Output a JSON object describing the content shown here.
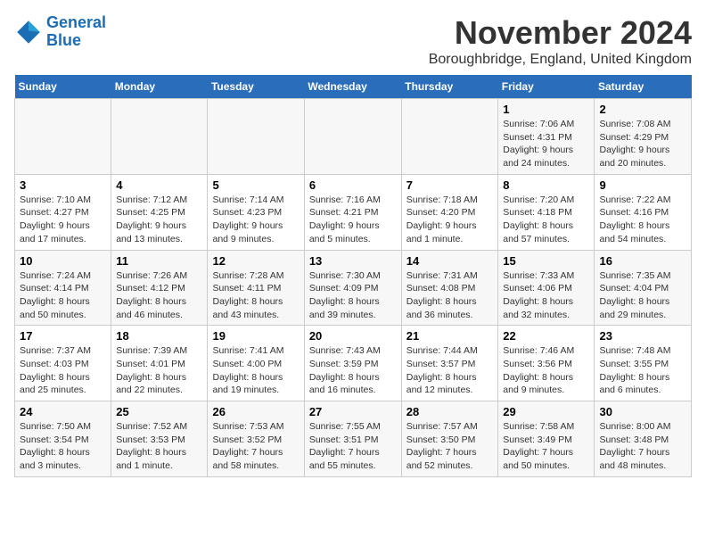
{
  "logo": {
    "line1": "General",
    "line2": "Blue"
  },
  "title": "November 2024",
  "location": "Boroughbridge, England, United Kingdom",
  "weekdays": [
    "Sunday",
    "Monday",
    "Tuesday",
    "Wednesday",
    "Thursday",
    "Friday",
    "Saturday"
  ],
  "weeks": [
    [
      {
        "day": "",
        "info": ""
      },
      {
        "day": "",
        "info": ""
      },
      {
        "day": "",
        "info": ""
      },
      {
        "day": "",
        "info": ""
      },
      {
        "day": "",
        "info": ""
      },
      {
        "day": "1",
        "info": "Sunrise: 7:06 AM\nSunset: 4:31 PM\nDaylight: 9 hours\nand 24 minutes."
      },
      {
        "day": "2",
        "info": "Sunrise: 7:08 AM\nSunset: 4:29 PM\nDaylight: 9 hours\nand 20 minutes."
      }
    ],
    [
      {
        "day": "3",
        "info": "Sunrise: 7:10 AM\nSunset: 4:27 PM\nDaylight: 9 hours\nand 17 minutes."
      },
      {
        "day": "4",
        "info": "Sunrise: 7:12 AM\nSunset: 4:25 PM\nDaylight: 9 hours\nand 13 minutes."
      },
      {
        "day": "5",
        "info": "Sunrise: 7:14 AM\nSunset: 4:23 PM\nDaylight: 9 hours\nand 9 minutes."
      },
      {
        "day": "6",
        "info": "Sunrise: 7:16 AM\nSunset: 4:21 PM\nDaylight: 9 hours\nand 5 minutes."
      },
      {
        "day": "7",
        "info": "Sunrise: 7:18 AM\nSunset: 4:20 PM\nDaylight: 9 hours\nand 1 minute."
      },
      {
        "day": "8",
        "info": "Sunrise: 7:20 AM\nSunset: 4:18 PM\nDaylight: 8 hours\nand 57 minutes."
      },
      {
        "day": "9",
        "info": "Sunrise: 7:22 AM\nSunset: 4:16 PM\nDaylight: 8 hours\nand 54 minutes."
      }
    ],
    [
      {
        "day": "10",
        "info": "Sunrise: 7:24 AM\nSunset: 4:14 PM\nDaylight: 8 hours\nand 50 minutes."
      },
      {
        "day": "11",
        "info": "Sunrise: 7:26 AM\nSunset: 4:12 PM\nDaylight: 8 hours\nand 46 minutes."
      },
      {
        "day": "12",
        "info": "Sunrise: 7:28 AM\nSunset: 4:11 PM\nDaylight: 8 hours\nand 43 minutes."
      },
      {
        "day": "13",
        "info": "Sunrise: 7:30 AM\nSunset: 4:09 PM\nDaylight: 8 hours\nand 39 minutes."
      },
      {
        "day": "14",
        "info": "Sunrise: 7:31 AM\nSunset: 4:08 PM\nDaylight: 8 hours\nand 36 minutes."
      },
      {
        "day": "15",
        "info": "Sunrise: 7:33 AM\nSunset: 4:06 PM\nDaylight: 8 hours\nand 32 minutes."
      },
      {
        "day": "16",
        "info": "Sunrise: 7:35 AM\nSunset: 4:04 PM\nDaylight: 8 hours\nand 29 minutes."
      }
    ],
    [
      {
        "day": "17",
        "info": "Sunrise: 7:37 AM\nSunset: 4:03 PM\nDaylight: 8 hours\nand 25 minutes."
      },
      {
        "day": "18",
        "info": "Sunrise: 7:39 AM\nSunset: 4:01 PM\nDaylight: 8 hours\nand 22 minutes."
      },
      {
        "day": "19",
        "info": "Sunrise: 7:41 AM\nSunset: 4:00 PM\nDaylight: 8 hours\nand 19 minutes."
      },
      {
        "day": "20",
        "info": "Sunrise: 7:43 AM\nSunset: 3:59 PM\nDaylight: 8 hours\nand 16 minutes."
      },
      {
        "day": "21",
        "info": "Sunrise: 7:44 AM\nSunset: 3:57 PM\nDaylight: 8 hours\nand 12 minutes."
      },
      {
        "day": "22",
        "info": "Sunrise: 7:46 AM\nSunset: 3:56 PM\nDaylight: 8 hours\nand 9 minutes."
      },
      {
        "day": "23",
        "info": "Sunrise: 7:48 AM\nSunset: 3:55 PM\nDaylight: 8 hours\nand 6 minutes."
      }
    ],
    [
      {
        "day": "24",
        "info": "Sunrise: 7:50 AM\nSunset: 3:54 PM\nDaylight: 8 hours\nand 3 minutes."
      },
      {
        "day": "25",
        "info": "Sunrise: 7:52 AM\nSunset: 3:53 PM\nDaylight: 8 hours\nand 1 minute."
      },
      {
        "day": "26",
        "info": "Sunrise: 7:53 AM\nSunset: 3:52 PM\nDaylight: 7 hours\nand 58 minutes."
      },
      {
        "day": "27",
        "info": "Sunrise: 7:55 AM\nSunset: 3:51 PM\nDaylight: 7 hours\nand 55 minutes."
      },
      {
        "day": "28",
        "info": "Sunrise: 7:57 AM\nSunset: 3:50 PM\nDaylight: 7 hours\nand 52 minutes."
      },
      {
        "day": "29",
        "info": "Sunrise: 7:58 AM\nSunset: 3:49 PM\nDaylight: 7 hours\nand 50 minutes."
      },
      {
        "day": "30",
        "info": "Sunrise: 8:00 AM\nSunset: 3:48 PM\nDaylight: 7 hours\nand 48 minutes."
      }
    ]
  ]
}
